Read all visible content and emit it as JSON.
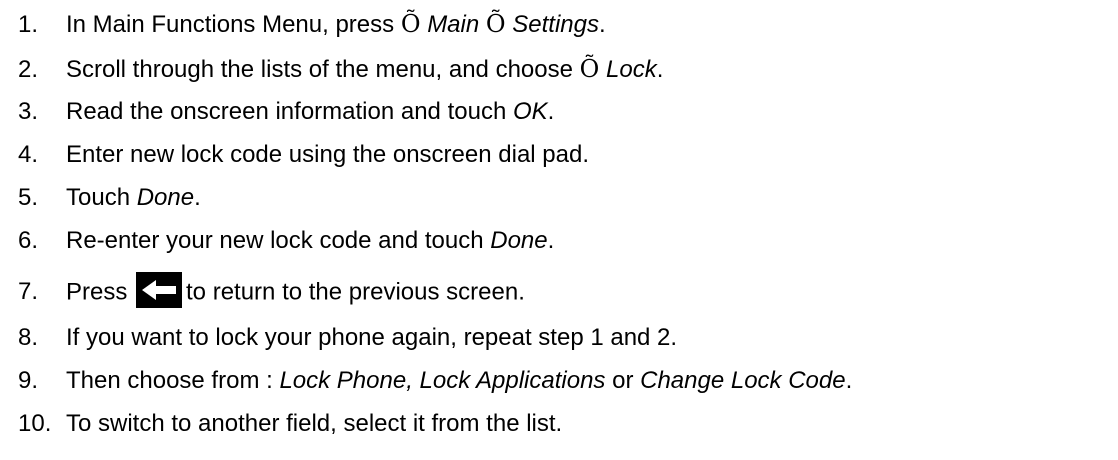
{
  "steps": [
    {
      "number": "1.",
      "parts": [
        "In Main Functions Menu, press ",
        "Õ",
        " ",
        "Main",
        " ",
        "Õ",
        " ",
        "Settings",
        "."
      ]
    },
    {
      "number": "2.",
      "parts": [
        "Scroll through the lists of the menu, and choose ",
        "Õ",
        " ",
        "Lock",
        "."
      ]
    },
    {
      "number": "3.",
      "parts": [
        "Read the onscreen information and touch ",
        "OK",
        "."
      ]
    },
    {
      "number": "4.",
      "text": "Enter new lock code using the onscreen dial pad."
    },
    {
      "number": "5.",
      "parts": [
        "Touch ",
        "Done",
        "."
      ]
    },
    {
      "number": "6.",
      "parts": [
        "Re-enter your new lock code and touch ",
        "Done",
        "."
      ]
    },
    {
      "number": "7.",
      "parts": [
        "Press ",
        "to return to the previous screen."
      ],
      "icon": "back-arrow-icon"
    },
    {
      "number": "8.",
      "text": "If you want to lock your phone again, repeat step 1 and 2."
    },
    {
      "number": "9.",
      "parts": [
        "Then choose from : ",
        "Lock Phone, Lock Applications",
        " or ",
        "Change Lock Code",
        "."
      ]
    },
    {
      "number": "10.",
      "text": "To switch to another field, select it from the list."
    }
  ],
  "colors": {
    "text": "#000000",
    "icon_bg": "#000000",
    "icon_arrow": "#ffffff"
  }
}
